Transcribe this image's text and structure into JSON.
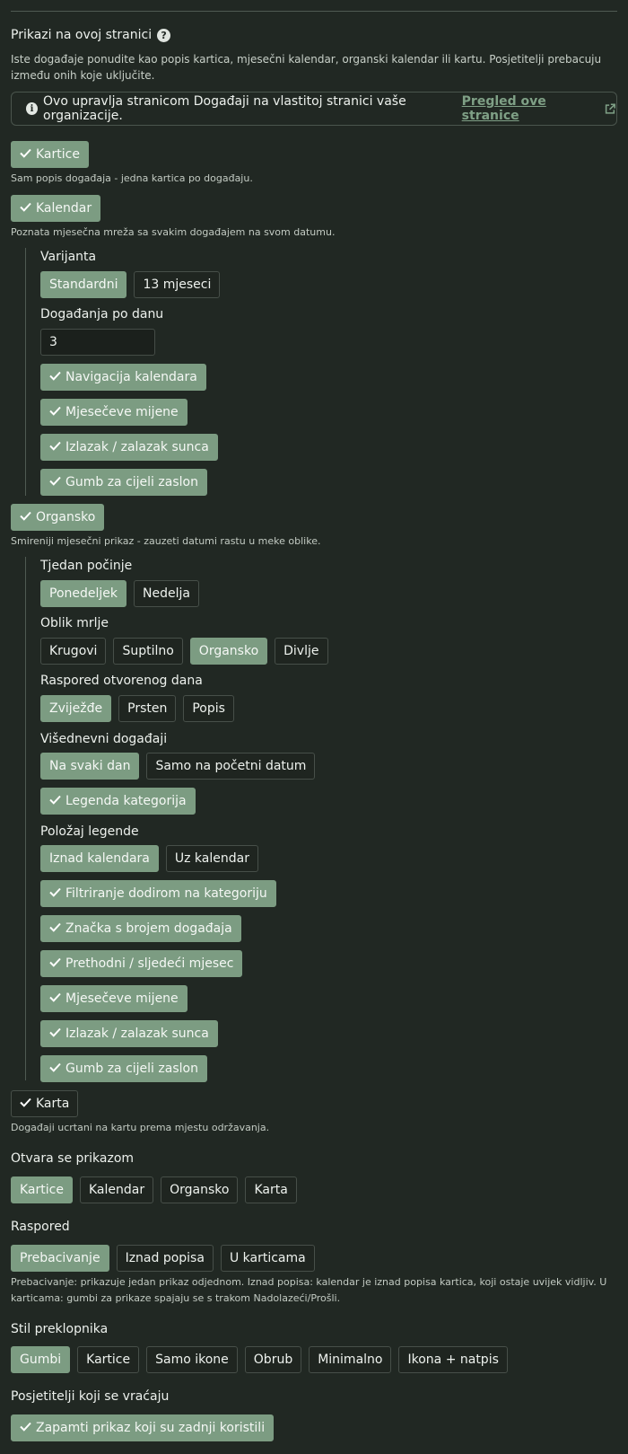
{
  "section": {
    "title": "Prikazi na ovoj stranici",
    "help": "?",
    "description": "Iste događaje ponudite kao popis kartica, mjesečni kalendar, organski kalendar ili kartu. Posjetitelji prebacuju između onih koje uključite.",
    "notice_text": "Ovo upravlja stranicom Događaji na vlastitoj stranici vaše organizacije.",
    "notice_link": "Pregled ove stranice"
  },
  "views": {
    "kartice": {
      "label": "Kartice",
      "desc": "Sam popis događaja - jedna kartica po događaju."
    },
    "kalendar": {
      "label": "Kalendar",
      "desc": "Poznata mjesečna mreža sa svakim događajem na svom datumu.",
      "variant_label": "Varijanta",
      "variants": [
        "Standardni",
        "13 mjeseci"
      ],
      "per_day_label": "Događanja po danu",
      "per_day_value": "3",
      "toggles": [
        "Navigacija kalendara",
        "Mjesečeve mijene",
        "Izlazak / zalazak sunca",
        "Gumb za cijeli zaslon"
      ]
    },
    "organsko": {
      "label": "Organsko",
      "desc": "Smireniji mjesečni prikaz - zauzeti datumi rastu u meke oblike.",
      "week_label": "Tjedan počinje",
      "week_options": [
        "Ponedeljek",
        "Nedelja"
      ],
      "blob_label": "Oblik mrlje",
      "blob_options": [
        "Krugovi",
        "Suptilno",
        "Organsko",
        "Divlje"
      ],
      "layout_label": "Raspored otvorenog dana",
      "layout_options": [
        "Zviježđe",
        "Prsten",
        "Popis"
      ],
      "multiday_label": "Višednevni događaji",
      "multiday_options": [
        "Na svaki dan",
        "Samo na početni datum"
      ],
      "legend_toggle": "Legenda kategorija",
      "legend_pos_label": "Položaj legende",
      "legend_pos_options": [
        "Iznad kalendara",
        "Uz kalendar"
      ],
      "toggles": [
        "Filtriranje dodirom na kategoriju",
        "Značka s brojem događaja",
        "Prethodni / sljedeći mjesec",
        "Mjesečeve mijene",
        "Izlazak / zalazak sunca",
        "Gumb za cijeli zaslon"
      ]
    },
    "karta": {
      "label": "Karta",
      "desc": "Događaji ucrtani na kartu prema mjestu održavanja."
    }
  },
  "opens_with": {
    "label": "Otvara se prikazom",
    "options": [
      "Kartice",
      "Kalendar",
      "Organsko",
      "Karta"
    ]
  },
  "raspored": {
    "label": "Raspored",
    "options": [
      "Prebacivanje",
      "Iznad popisa",
      "U karticama"
    ],
    "desc": "Prebacivanje: prikazuje jedan prikaz odjednom. Iznad popisa: kalendar je iznad popisa kartica, koji ostaje uvijek vidljiv. U karticama: gumbi za prikaze spajaju se s trakom Nadolazeći/Prošli."
  },
  "switcher": {
    "label": "Stil preklopnika",
    "options": [
      "Gumbi",
      "Kartice",
      "Samo ikone",
      "Obrub",
      "Minimalno",
      "Ikona + natpis"
    ]
  },
  "returning": {
    "label": "Posjetitelji koji se vraćaju",
    "toggle": "Zapamti prikaz koji su zadnji koristili"
  },
  "colors": {
    "background": "#212823",
    "accent": "#7c9c82",
    "link": "#7fa086"
  }
}
